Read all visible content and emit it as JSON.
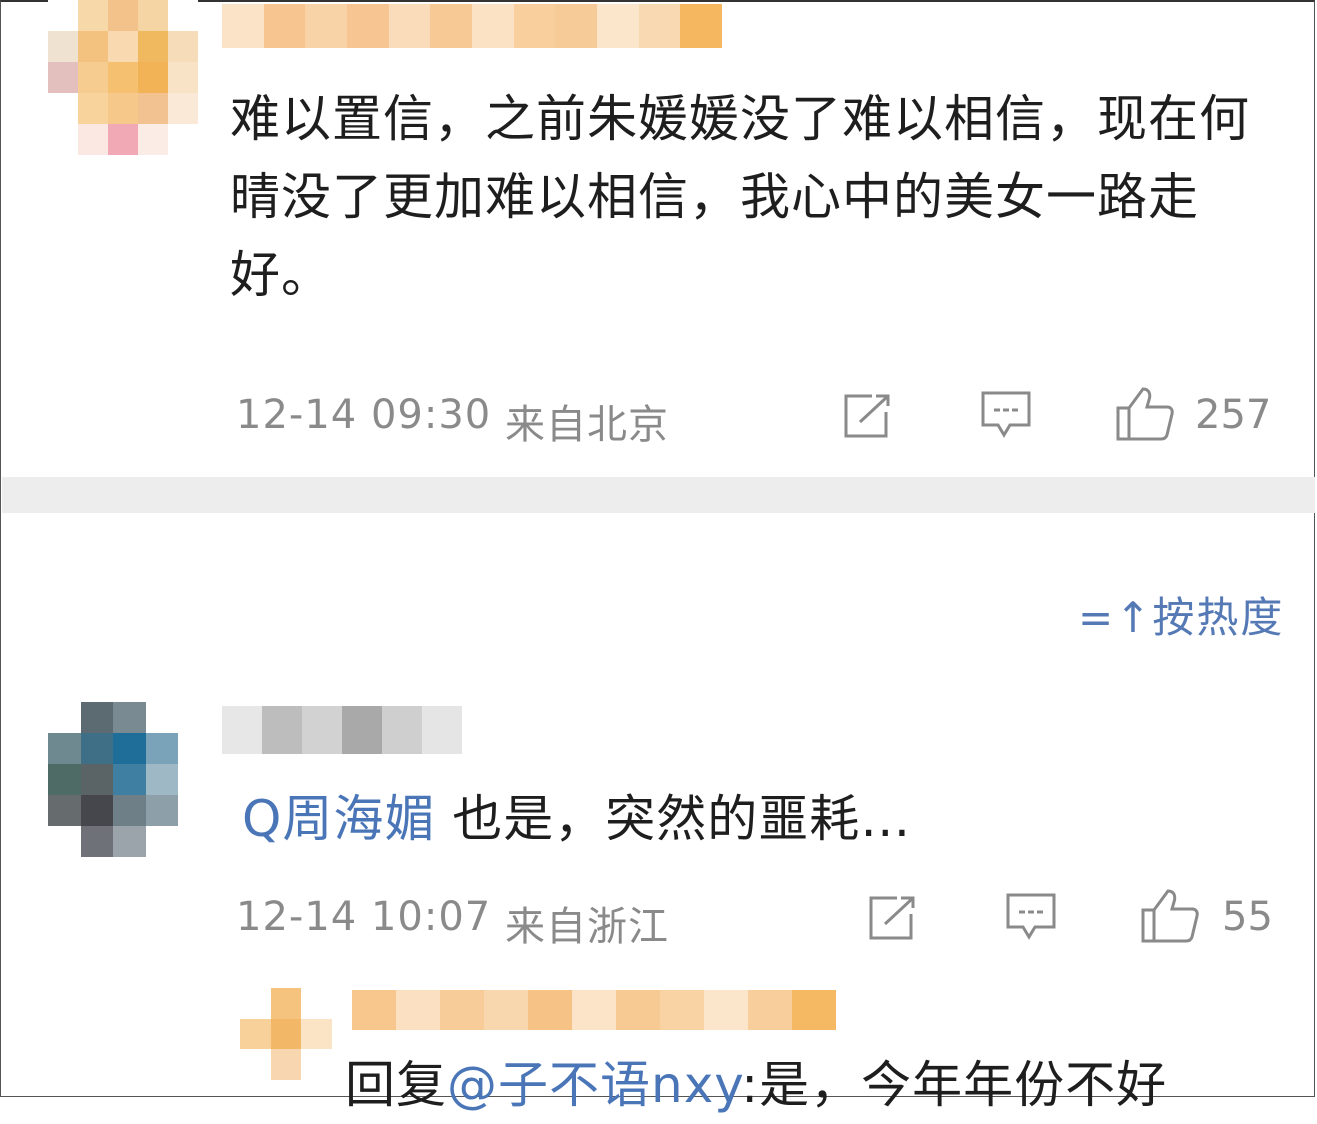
{
  "comments": [
    {
      "text": "难以置信，之前朱媛媛没了难以相信，现在何晴没了更加难以相信，我心中的美女一路走好。",
      "time": "12-14 09:30",
      "location": "来自北京",
      "likes": "257"
    },
    {
      "topic_prefix": "Q",
      "topic": "周海媚",
      "text": " 也是，突然的噩耗…",
      "time": "12-14 10:07",
      "location": "来自浙江",
      "likes": "55"
    }
  ],
  "sort": {
    "icon": "=↑",
    "label": "按热度"
  },
  "reply": {
    "prefix": "回复",
    "mention": "@子不语nxy",
    "text": ":是，今年年份不好"
  },
  "icons": [
    "share-icon",
    "comment-icon",
    "like-icon",
    "search-topic-icon",
    "sort-icon"
  ],
  "colors": {
    "link": "#4a76b8",
    "meta": "#8a8a8a",
    "divider": "#ededed"
  }
}
